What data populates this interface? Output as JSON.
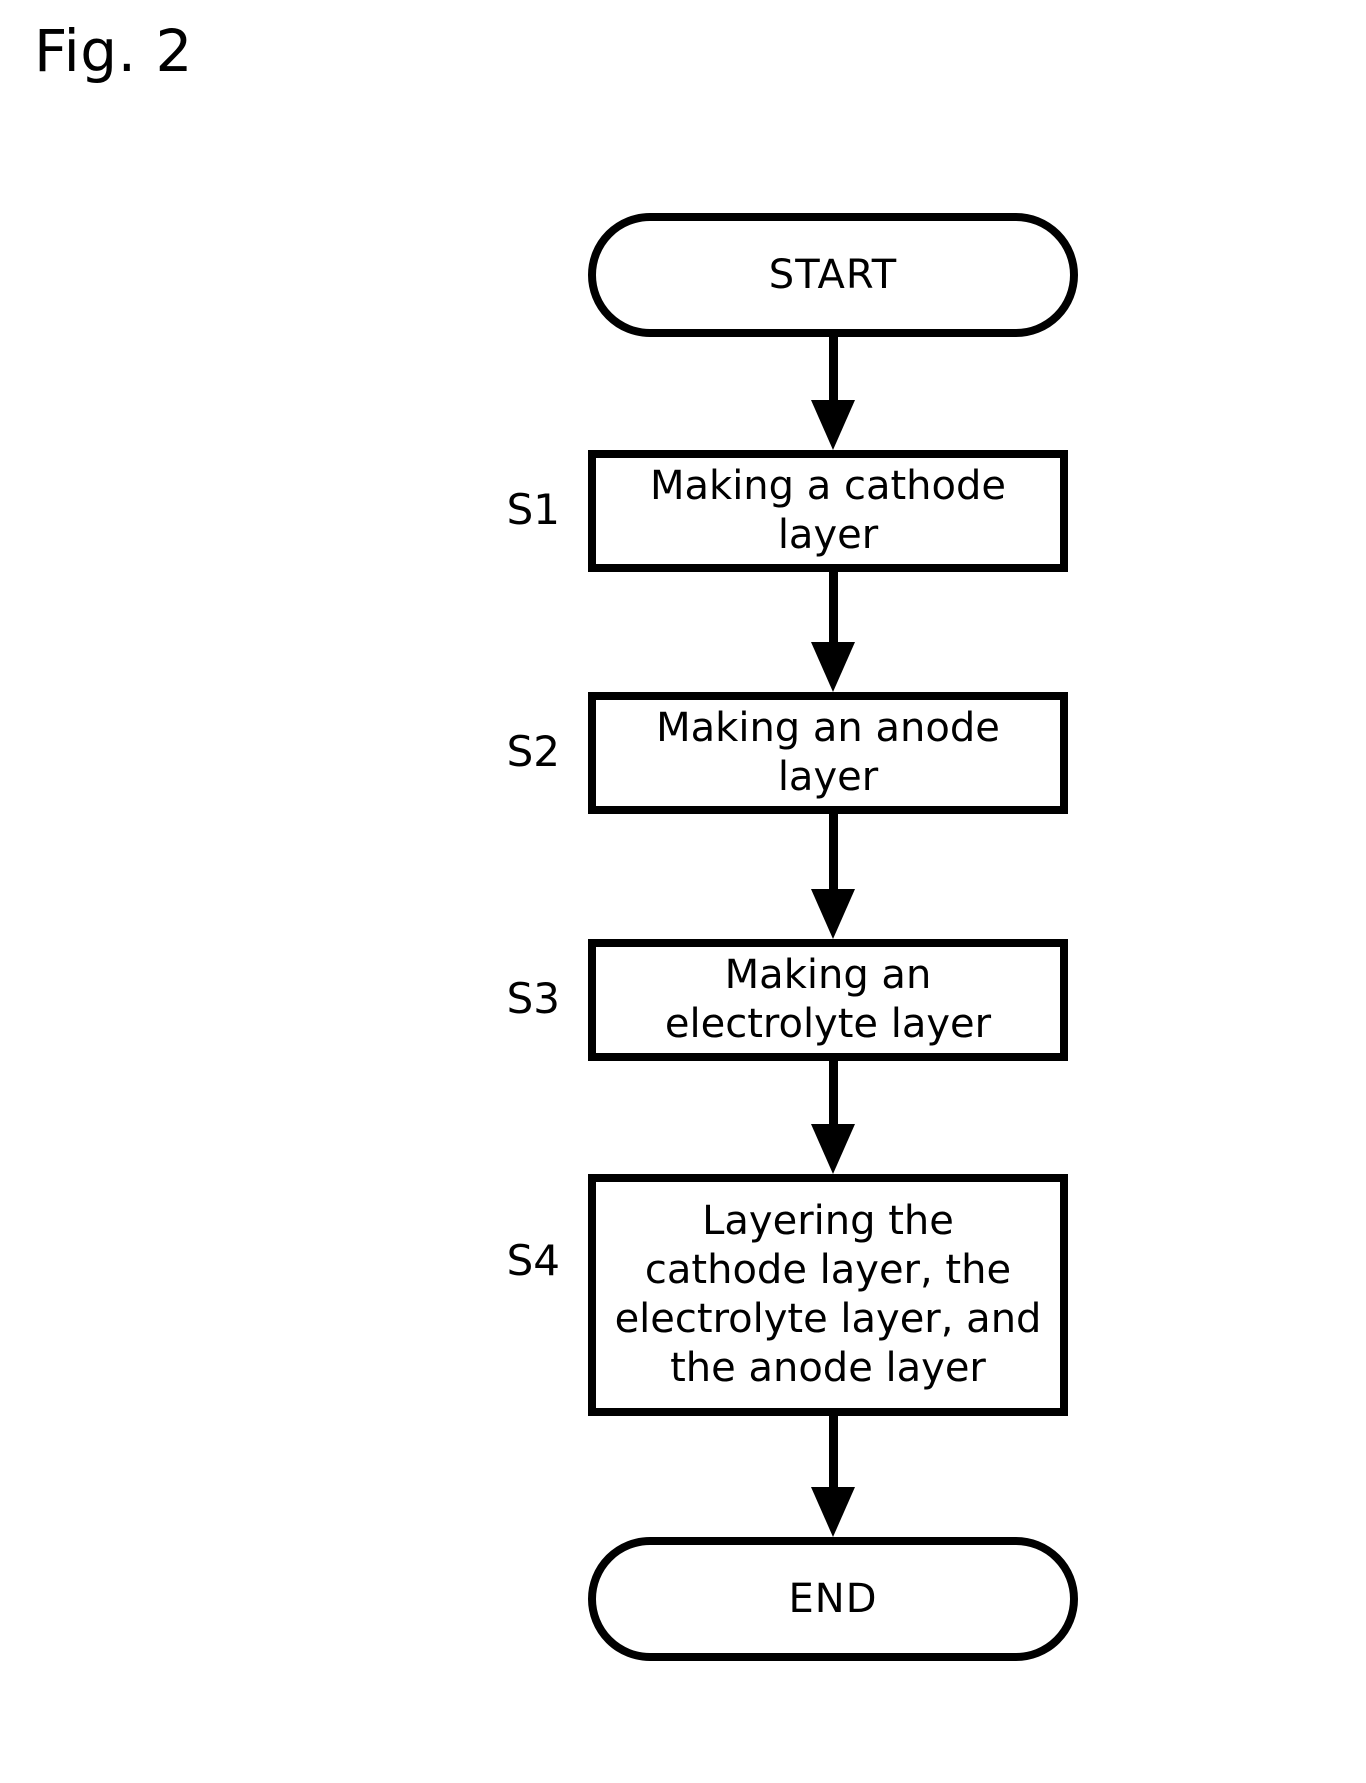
{
  "figure": {
    "label": "Fig. 2"
  },
  "flowchart": {
    "title": "Fig. 2",
    "orientation": "vertical",
    "nodes": [
      {
        "id": "start",
        "type": "terminal",
        "text": "START",
        "step_label": ""
      },
      {
        "id": "s1",
        "type": "process",
        "text": "Making a cathode\nlayer",
        "step_label": "S1"
      },
      {
        "id": "s2",
        "type": "process",
        "text": "Making an anode\nlayer",
        "step_label": "S2"
      },
      {
        "id": "s3",
        "type": "process",
        "text": "Making an\nelectrolyte layer",
        "step_label": "S3"
      },
      {
        "id": "s4",
        "type": "process",
        "text": "Layering the\ncathode layer, the\nelectrolyte layer, and\nthe anode layer",
        "step_label": "S4"
      },
      {
        "id": "end",
        "type": "terminal",
        "text": "END",
        "step_label": ""
      }
    ],
    "edges": [
      {
        "from": "start",
        "to": "s1"
      },
      {
        "from": "s1",
        "to": "s2"
      },
      {
        "from": "s2",
        "to": "s3"
      },
      {
        "from": "s3",
        "to": "s4"
      },
      {
        "from": "s4",
        "to": "end"
      }
    ],
    "colors": {
      "stroke": "#000000",
      "fill": "#ffffff",
      "text": "#000000"
    }
  }
}
